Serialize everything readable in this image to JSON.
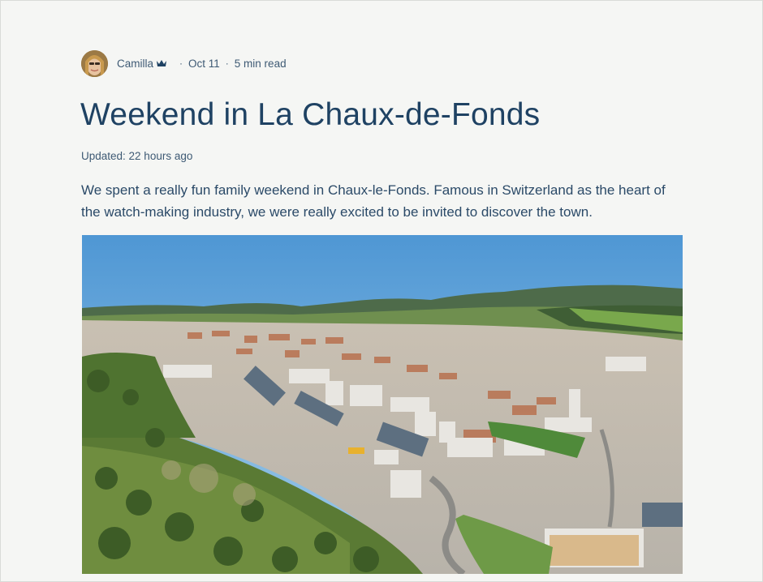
{
  "post": {
    "author": "Camilla",
    "author_icon": "crown-icon",
    "date": "Oct 11",
    "read_time": "5 min read",
    "separator": "·",
    "title": "Weekend in La Chaux-de-Fonds",
    "updated": "Updated: 22 hours ago",
    "intro": "We spent a really fun family weekend in Chaux-le-Fonds.  Famous in Switzerland as the heart of the watch-making industry, we were really excited to be invited to discover the town."
  },
  "colors": {
    "background": "#f5f6f4",
    "title": "#1f4263",
    "meta": "#3e5a74",
    "sky": "#5fa3d8"
  }
}
